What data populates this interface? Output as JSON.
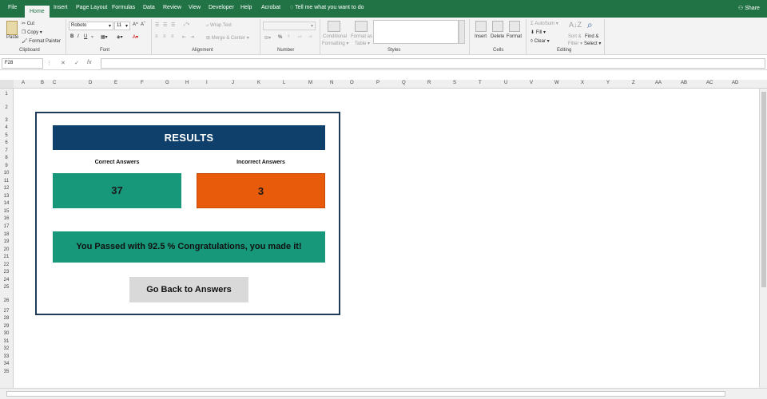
{
  "tabs": [
    "File",
    "Home",
    "Insert",
    "Page Layout",
    "Formulas",
    "Data",
    "Review",
    "View",
    "Developer",
    "Help",
    "Acrobat"
  ],
  "tell_me": "Tell me what you want to do",
  "share": "Share",
  "ribbon": {
    "clipboard": {
      "paste": "Paste",
      "cut": "Cut",
      "copy": "Copy",
      "format_painter": "Format Painter",
      "label": "Clipboard"
    },
    "font": {
      "name": "Roboto",
      "size": "11",
      "label": "Font"
    },
    "alignment": {
      "wrap_text": "Wrap Text",
      "merge_center": "Merge & Center",
      "label": "Alignment"
    },
    "number": {
      "label": "Number",
      "percent": "%"
    },
    "styles": {
      "conditional": "Conditional",
      "formatting": "Formatting",
      "format_as": "Format as",
      "table": "Table",
      "label": "Styles"
    },
    "cells": {
      "insert": "Insert",
      "delete": "Delete",
      "format": "Format",
      "label": "Cells"
    },
    "editing": {
      "autosum": "AutoSum",
      "fill": "Fill",
      "clear": "Clear",
      "sort": "Sort &",
      "filter": "Filter",
      "find": "Find &",
      "select": "Select",
      "label": "Editing"
    }
  },
  "formula_bar": {
    "name_box": "F28",
    "content": ""
  },
  "columns": [
    "A",
    "B",
    "C",
    "D",
    "E",
    "F",
    "G",
    "H",
    "I",
    "J",
    "K",
    "L",
    "M",
    "N",
    "O",
    "P",
    "Q",
    "R",
    "S",
    "T",
    "U",
    "V",
    "W",
    "X",
    "Y",
    "Z",
    "AA",
    "AB",
    "AC",
    "AD"
  ],
  "rows": [
    "1",
    "2",
    "3",
    "4",
    "5",
    "6",
    "7",
    "8",
    "9",
    "10",
    "11",
    "12",
    "13",
    "14",
    "15",
    "16",
    "17",
    "18",
    "19",
    "20",
    "21",
    "22",
    "23",
    "24",
    "25",
    "26",
    "27",
    "28",
    "29",
    "30",
    "31",
    "32",
    "33",
    "34",
    "35"
  ],
  "card": {
    "title": "RESULTS",
    "correct_label": "Correct Answers",
    "incorrect_label": "Incorrect Answers",
    "correct_value": "37",
    "incorrect_value": "3",
    "message": "You Passed with 92.5 % Congratulations, you made it!",
    "back_button": "Go Back to Answers"
  },
  "colors": {
    "excel_green": "#217346",
    "header_blue": "#0f3f6b",
    "correct_green": "#17987a",
    "incorrect_orange": "#e85b0b",
    "button_gray": "#d9d9d9"
  }
}
